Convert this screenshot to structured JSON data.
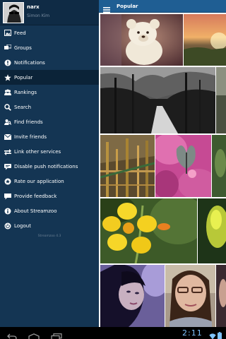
{
  "profile": {
    "name": "narx",
    "subtitle": "Simon Kim"
  },
  "menu": [
    {
      "label": "Feed",
      "icon": "image-icon"
    },
    {
      "label": "Groups",
      "icon": "groups-icon"
    },
    {
      "label": "Notifications",
      "icon": "notification-icon"
    },
    {
      "label": "Popular",
      "icon": "star-icon",
      "active": true
    },
    {
      "label": "Rankings",
      "icon": "rankings-icon"
    },
    {
      "label": "Search",
      "icon": "search-icon"
    },
    {
      "label": "Find friends",
      "icon": "find-friends-icon"
    },
    {
      "label": "Invite friends",
      "icon": "mail-icon"
    },
    {
      "label": "Link other services",
      "icon": "link-icon"
    },
    {
      "label": "Disable push notifications",
      "icon": "push-icon"
    },
    {
      "label": "Rate our application",
      "icon": "rate-icon"
    },
    {
      "label": "Provide feedback",
      "icon": "feedback-icon"
    },
    {
      "label": "About Streamzoo",
      "icon": "info-icon"
    },
    {
      "label": "Logout",
      "icon": "power-icon"
    }
  ],
  "version": "Streamzoo 4.3",
  "appbar": {
    "title": "Popular"
  },
  "statusbar": {
    "time": "2:11"
  },
  "colors": {
    "sidebar": "#143553",
    "appbar": "#1f5e93",
    "active_item": "#0b2338",
    "clock": "#7fc4ff"
  }
}
